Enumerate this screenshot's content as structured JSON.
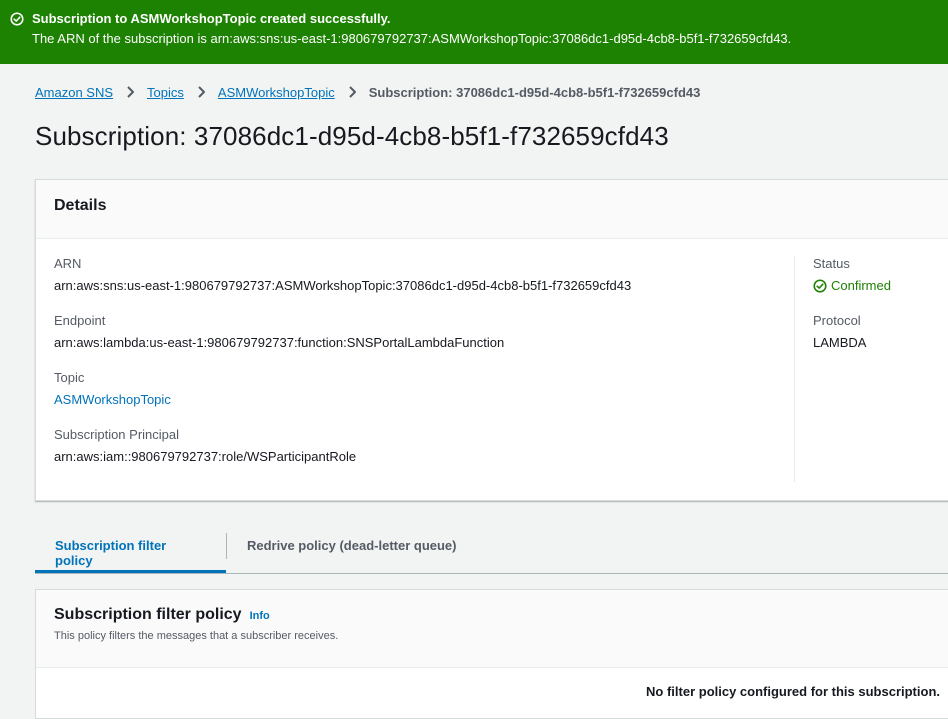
{
  "flash": {
    "title": "Subscription to ASMWorkshopTopic created successfully.",
    "message": "The ARN of the subscription is arn:aws:sns:us-east-1:980679792737:ASMWorkshopTopic:37086dc1-d95d-4cb8-b5f1-f732659cfd43.",
    "icon": "success-circle-icon",
    "color": "#1d8102"
  },
  "breadcrumb": {
    "items": [
      "Amazon SNS",
      "Topics",
      "ASMWorkshopTopic"
    ],
    "current": "Subscription: 37086dc1-d95d-4cb8-b5f1-f732659cfd43"
  },
  "page": {
    "title": "Subscription: 37086dc1-d95d-4cb8-b5f1-f732659cfd43"
  },
  "details": {
    "title": "Details",
    "arn_label": "ARN",
    "arn_value": "arn:aws:sns:us-east-1:980679792737:ASMWorkshopTopic:37086dc1-d95d-4cb8-b5f1-f732659cfd43",
    "endpoint_label": "Endpoint",
    "endpoint_value": "arn:aws:lambda:us-east-1:980679792737:function:SNSPortalLambdaFunction",
    "topic_label": "Topic",
    "topic_value": "ASMWorkshopTopic",
    "principal_label": "Subscription Principal",
    "principal_value": "arn:aws:iam::980679792737:role/WSParticipantRole",
    "status_label": "Status",
    "status_value": "Confirmed",
    "protocol_label": "Protocol",
    "protocol_value": "LAMBDA"
  },
  "tabs": [
    {
      "label": "Subscription filter policy",
      "active": true
    },
    {
      "label": "Redrive policy (dead-letter queue)",
      "active": false
    }
  ],
  "filter_policy": {
    "title": "Subscription filter policy",
    "info": "Info",
    "description": "This policy filters the messages that a subscriber receives.",
    "empty": "No filter policy configured for this subscription."
  },
  "colors": {
    "link": "#0073bb",
    "success": "#1d8102"
  }
}
